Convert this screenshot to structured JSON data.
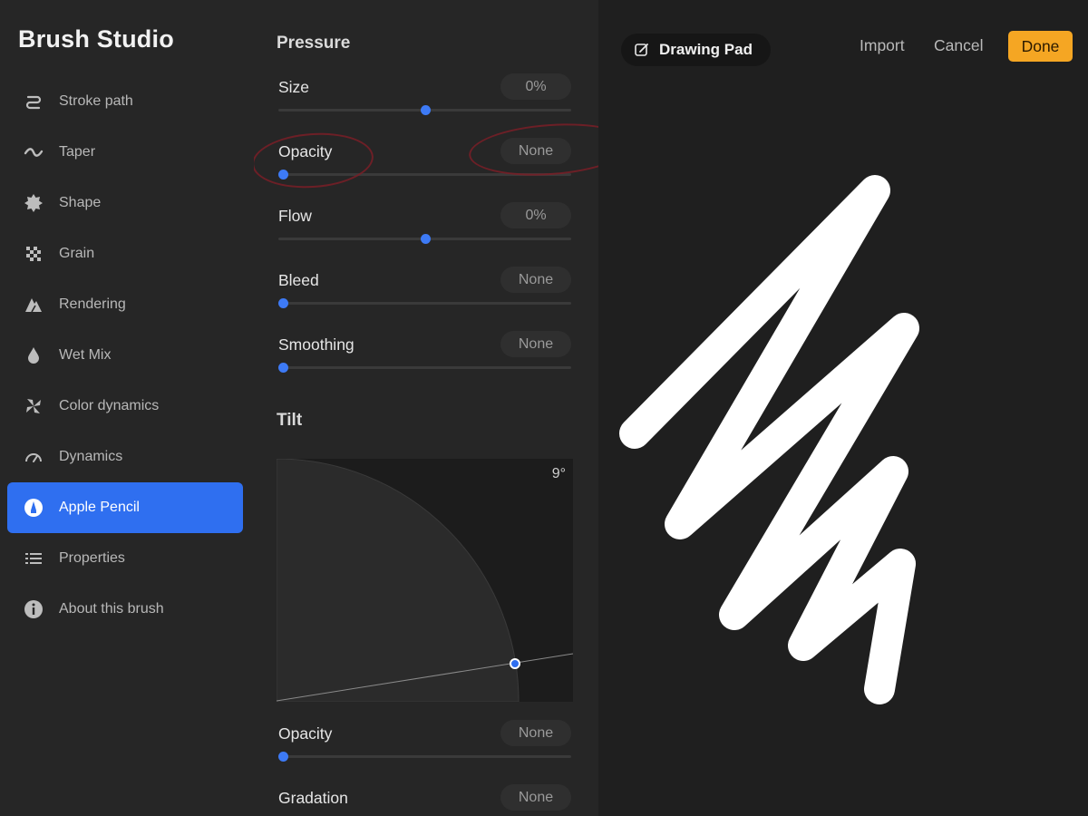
{
  "sidebar": {
    "title": "Brush Studio",
    "items": [
      {
        "label": "Stroke path",
        "icon": "stroke-path-icon",
        "active": false
      },
      {
        "label": "Taper",
        "icon": "taper-icon",
        "active": false
      },
      {
        "label": "Shape",
        "icon": "shape-icon",
        "active": false
      },
      {
        "label": "Grain",
        "icon": "grain-icon",
        "active": false
      },
      {
        "label": "Rendering",
        "icon": "rendering-icon",
        "active": false
      },
      {
        "label": "Wet Mix",
        "icon": "wet-mix-icon",
        "active": false
      },
      {
        "label": "Color dynamics",
        "icon": "color-dynamics-icon",
        "active": false
      },
      {
        "label": "Dynamics",
        "icon": "dynamics-icon",
        "active": false
      },
      {
        "label": "Apple Pencil",
        "icon": "apple-pencil-icon",
        "active": true
      },
      {
        "label": "Properties",
        "icon": "properties-icon",
        "active": false
      },
      {
        "label": "About this brush",
        "icon": "info-icon",
        "active": false
      }
    ]
  },
  "pressure": {
    "title": "Pressure",
    "rows": [
      {
        "label": "Size",
        "value": "0%",
        "level": 0.5
      },
      {
        "label": "Opacity",
        "value": "None",
        "level": 0
      },
      {
        "label": "Flow",
        "value": "0%",
        "level": 0.5
      },
      {
        "label": "Bleed",
        "value": "None",
        "level": 0
      },
      {
        "label": "Smoothing",
        "value": "None",
        "level": 0
      }
    ]
  },
  "tilt": {
    "title": "Tilt",
    "angle": "9°",
    "rows": [
      {
        "label": "Opacity",
        "value": "None",
        "level": 0
      },
      {
        "label": "Gradation",
        "value": "None",
        "level": 0
      }
    ]
  },
  "pad": {
    "title": "Drawing Pad",
    "import_label": "Import",
    "cancel_label": "Cancel",
    "done_label": "Done"
  },
  "colors": {
    "accent": "#2f6ff0",
    "done": "#f5a623",
    "slider": "#3d7af5",
    "annotation": "#7a1f27"
  }
}
